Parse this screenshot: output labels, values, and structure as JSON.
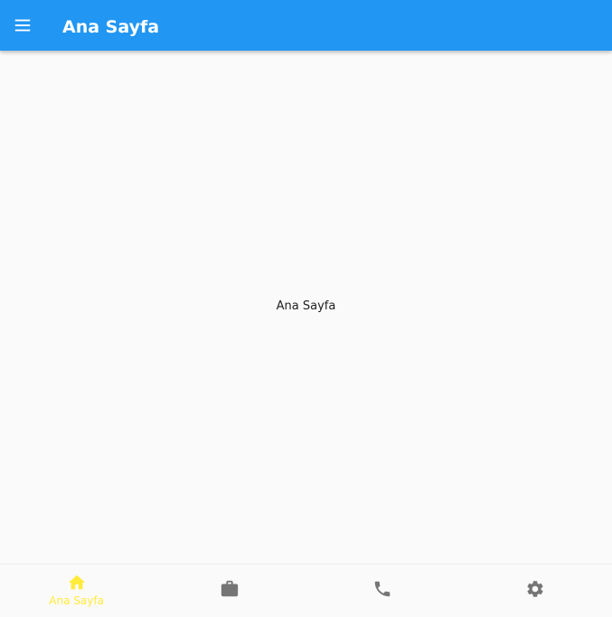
{
  "appbar": {
    "title": "Ana Sayfa",
    "menu_icon": "menu-icon",
    "color": "#2196f3"
  },
  "body": {
    "text": "Ana Sayfa"
  },
  "bottom_nav": {
    "active_color": "#ffeb3b",
    "inactive_color": "#757575",
    "items": [
      {
        "label": "Ana Sayfa",
        "icon": "home-icon",
        "active": true
      },
      {
        "label": "",
        "icon": "briefcase-icon",
        "active": false
      },
      {
        "label": "",
        "icon": "phone-icon",
        "active": false
      },
      {
        "label": "",
        "icon": "gear-icon",
        "active": false
      }
    ]
  }
}
